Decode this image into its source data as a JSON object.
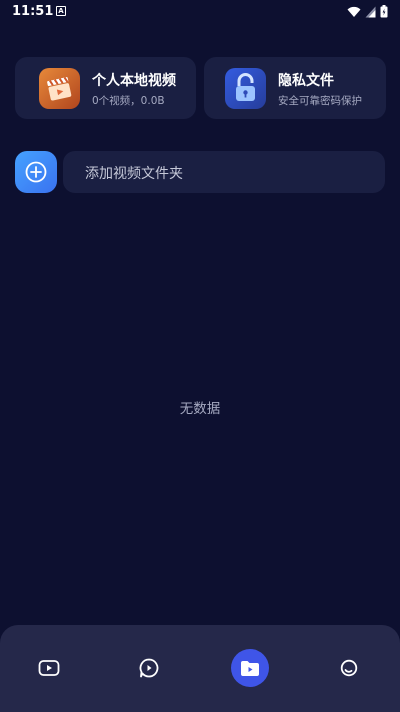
{
  "status_bar": {
    "time": "11:51",
    "notification_glyph": "A",
    "icons": [
      "wifi-icon",
      "signal-icon",
      "battery-icon"
    ]
  },
  "cards": {
    "local_videos": {
      "title": "个人本地视频",
      "subtitle": "0个视频，0.0B",
      "icon": "clapperboard-icon"
    },
    "private_files": {
      "title": "隐私文件",
      "subtitle": "安全可靠密码保护",
      "icon": "lock-icon"
    }
  },
  "add_folder": {
    "label": "添加视频文件夹",
    "icon": "plus-circle-icon"
  },
  "empty_state": {
    "text": "无数据"
  },
  "bottom_nav": {
    "items": [
      {
        "icon": "video-play-icon",
        "active": false
      },
      {
        "icon": "chat-play-icon",
        "active": false
      },
      {
        "icon": "folder-play-icon",
        "active": true
      },
      {
        "icon": "profile-circle-icon",
        "active": false
      }
    ]
  },
  "colors": {
    "background": "#0d1030",
    "card": "#1a1f42",
    "nav_background": "#25284a",
    "accent": "#3f55e8"
  }
}
